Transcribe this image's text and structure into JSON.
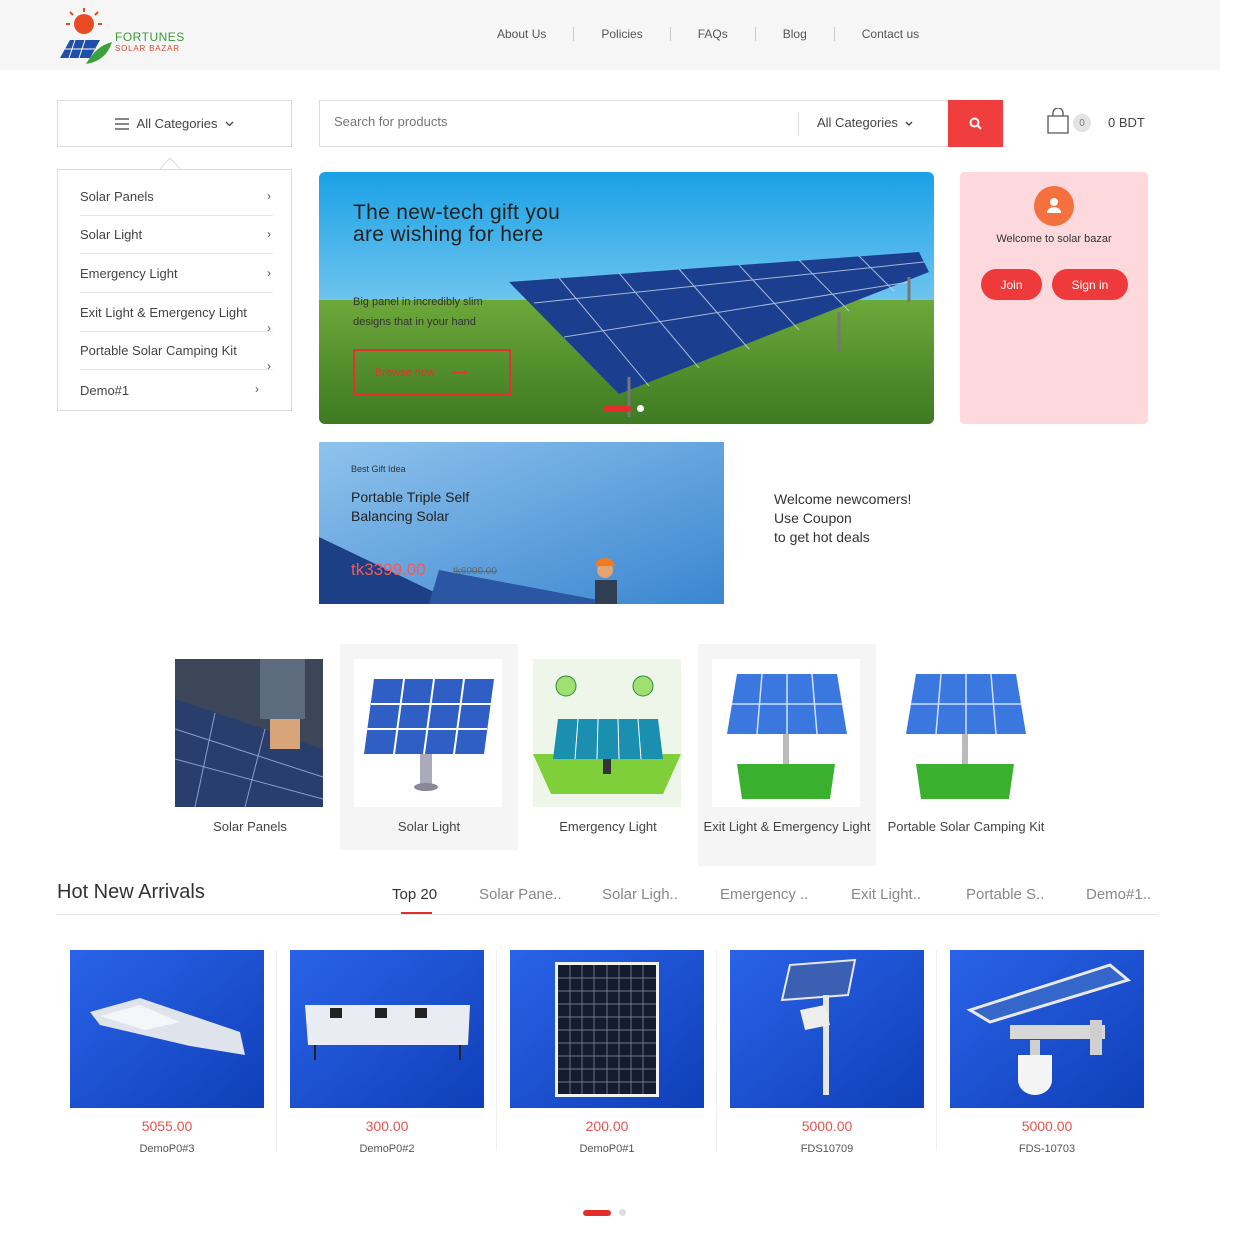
{
  "header": {
    "logo": {
      "line1": "FORTUNES",
      "line2": "SOLAR BAZAR"
    },
    "nav": [
      "About Us",
      "Policies",
      "FAQs",
      "Blog",
      "Contact us"
    ]
  },
  "category_button": {
    "label": "All Categories"
  },
  "category_menu": [
    "Solar Panels",
    "Solar Light",
    "Emergency Light",
    "Exit Light & Emergency Light",
    "Portable Solar Camping Kit",
    "Demo#1"
  ],
  "search": {
    "placeholder": "Search for products",
    "category": "All Categories"
  },
  "cart": {
    "count": "0",
    "total": "0  BDT"
  },
  "hero": {
    "title": "The new-tech gift you are wishing for here",
    "subtitle": "Big panel in incredibly slim designs that in your hand",
    "button": "Browse now",
    "slides": 2,
    "active_slide": 1
  },
  "welcome": {
    "message": "Welcome to solar bazar",
    "join": "Join",
    "signin": "Sign in"
  },
  "promo": {
    "tag": "Best Gift Idea",
    "title": "Portable Triple Self Balancing Solar",
    "price": "tk3399.00",
    "old_price": "tk6000.00"
  },
  "coupon": {
    "line1": "Welcome newcomers!",
    "line2": "Use Coupon",
    "line3": "to get hot deals"
  },
  "category_tiles": [
    "Solar Panels",
    "Solar Light",
    "Emergency Light",
    "Exit Light & Emergency Light",
    "Portable Solar Camping Kit"
  ],
  "hot": {
    "title": "Hot New Arrivals",
    "tabs": [
      "Top 20",
      "Solar Pane..",
      "Solar Ligh..",
      "Emergency ..",
      "Exit Light..",
      "Portable S..",
      "Demo#1.."
    ],
    "active_tab": 0,
    "products": [
      {
        "price": "5055.00",
        "name": "DemoP0#3"
      },
      {
        "price": "300.00",
        "name": "DemoP0#2"
      },
      {
        "price": "200.00",
        "name": "DemoP0#1"
      },
      {
        "price": "5000.00",
        "name": "FDS10709"
      },
      {
        "price": "5000.00",
        "name": "FDS-10703"
      }
    ],
    "pages": 2,
    "active_page": 1
  },
  "colors": {
    "accent": "#f03d3d",
    "welcome_bg": "#fdd9dd",
    "product_bg": "#1d4fd6"
  }
}
